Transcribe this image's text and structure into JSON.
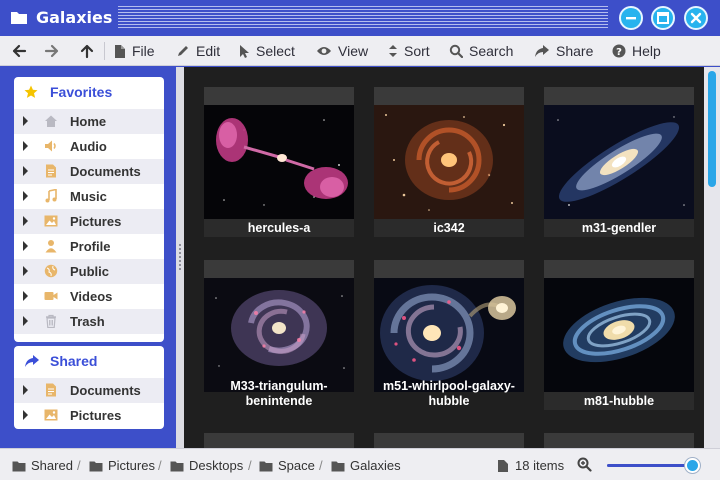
{
  "window": {
    "title": "Galaxies",
    "accent": "#3d4fc9",
    "button_color": "#27b3ee"
  },
  "toolbar": {
    "back_icon": "arrow-left-icon",
    "forward_icon": "arrow-right-icon",
    "up_icon": "arrow-up-icon",
    "items": [
      {
        "label": "File",
        "icon": "file-icon"
      },
      {
        "label": "Edit",
        "icon": "pencil-icon"
      },
      {
        "label": "Select",
        "icon": "cursor-icon"
      },
      {
        "label": "View",
        "icon": "eye-icon"
      },
      {
        "label": "Sort",
        "icon": "sort-icon"
      },
      {
        "label": "Search",
        "icon": "search-icon"
      },
      {
        "label": "Share",
        "icon": "share-icon"
      },
      {
        "label": "Help",
        "icon": "help-icon"
      }
    ]
  },
  "sidebar": {
    "favorites": {
      "title": "Favorites",
      "icon": "star-icon",
      "items": [
        {
          "label": "Home",
          "icon": "home-icon"
        },
        {
          "label": "Audio",
          "icon": "speaker-icon"
        },
        {
          "label": "Documents",
          "icon": "document-icon"
        },
        {
          "label": "Music",
          "icon": "music-note-icon"
        },
        {
          "label": "Pictures",
          "icon": "image-icon"
        },
        {
          "label": "Profile",
          "icon": "person-icon"
        },
        {
          "label": "Public",
          "icon": "globe-icon"
        },
        {
          "label": "Videos",
          "icon": "video-camera-icon"
        },
        {
          "label": "Trash",
          "icon": "trash-icon"
        }
      ]
    },
    "shared": {
      "title": "Shared",
      "icon": "share-icon",
      "items": [
        {
          "label": "Documents",
          "icon": "document-icon"
        },
        {
          "label": "Pictures",
          "icon": "image-icon"
        }
      ]
    }
  },
  "content": {
    "files": [
      {
        "name": "hercules-a"
      },
      {
        "name": "ic342"
      },
      {
        "name": "m31-gendler"
      },
      {
        "name": "M33-triangulum-benintende"
      },
      {
        "name": "m51-whirlpool-galaxy-hubble"
      },
      {
        "name": "m81-hubble"
      }
    ]
  },
  "statusbar": {
    "breadcrumb": [
      "Shared",
      "Pictures",
      "Desktops",
      "Space",
      "Galaxies"
    ],
    "item_count": "18 items",
    "zoom_level": 0.93
  }
}
